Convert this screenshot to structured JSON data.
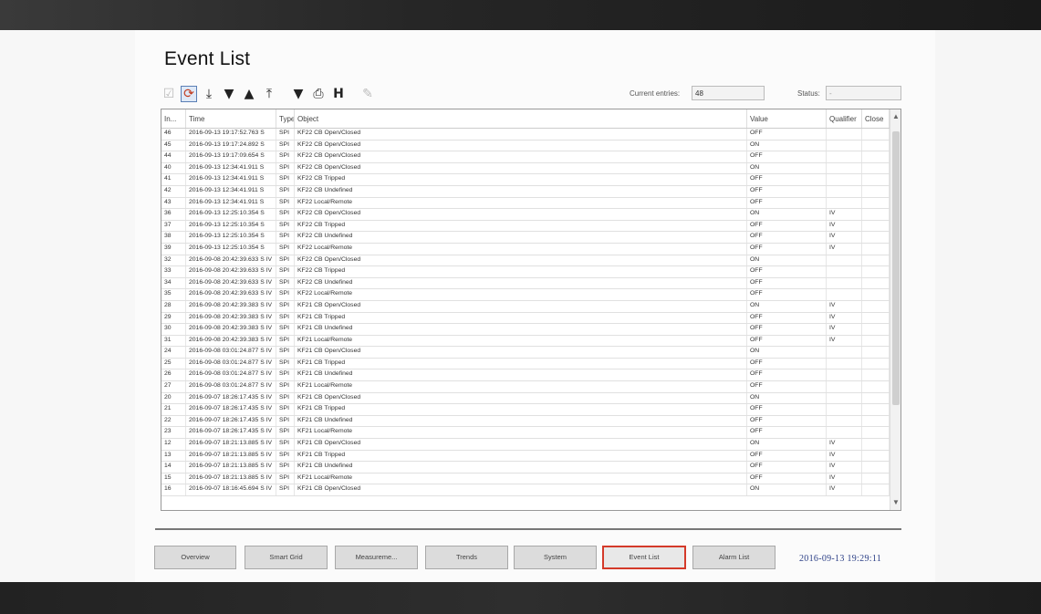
{
  "title": "Event List",
  "toolbar": {
    "buttons": [
      {
        "icon": "acknowledge-icon"
      },
      {
        "icon": "refresh-icon"
      },
      {
        "icon": "jump-first-icon"
      },
      {
        "icon": "move-down-icon"
      },
      {
        "icon": "move-up-icon"
      },
      {
        "icon": "jump-last-icon"
      },
      {
        "icon": "filter-icon"
      },
      {
        "icon": "print-icon"
      },
      {
        "icon": "history-icon"
      },
      {
        "icon": "edit-icon"
      }
    ]
  },
  "current_entries": {
    "label": "Current entries:",
    "value": "48"
  },
  "status": {
    "label": "Status:",
    "value": "-"
  },
  "columns": [
    "In...",
    "Time",
    "Type",
    "Object",
    "Value",
    "Qualifier",
    "Close"
  ],
  "rows": [
    {
      "id": "46",
      "time": "2016-09-13 19:17:52.763 S",
      "type": "SPI",
      "object": "KF22 CB Open/Closed",
      "value": "OFF",
      "qualifier": ""
    },
    {
      "id": "45",
      "time": "2016-09-13 19:17:24.892 S",
      "type": "SPI",
      "object": "KF22 CB Open/Closed",
      "value": "ON",
      "qualifier": ""
    },
    {
      "id": "44",
      "time": "2016-09-13 19:17:09.654 S",
      "type": "SPI",
      "object": "KF22 CB Open/Closed",
      "value": "OFF",
      "qualifier": ""
    },
    {
      "id": "40",
      "time": "2016-09-13 12:34:41.911 S",
      "type": "SPI",
      "object": "KF22 CB Open/Closed",
      "value": "ON",
      "qualifier": ""
    },
    {
      "id": "41",
      "time": "2016-09-13 12:34:41.911 S",
      "type": "SPI",
      "object": "KF22 CB Tripped",
      "value": "OFF",
      "qualifier": ""
    },
    {
      "id": "42",
      "time": "2016-09-13 12:34:41.911 S",
      "type": "SPI",
      "object": "KF22 CB Undefined",
      "value": "OFF",
      "qualifier": ""
    },
    {
      "id": "43",
      "time": "2016-09-13 12:34:41.911 S",
      "type": "SPI",
      "object": "KF22 Local/Remote",
      "value": "OFF",
      "qualifier": ""
    },
    {
      "id": "36",
      "time": "2016-09-13 12:25:10.354 S",
      "type": "SPI",
      "object": "KF22 CB Open/Closed",
      "value": "ON",
      "qualifier": "IV"
    },
    {
      "id": "37",
      "time": "2016-09-13 12:25:10.354 S",
      "type": "SPI",
      "object": "KF22 CB Tripped",
      "value": "OFF",
      "qualifier": "IV"
    },
    {
      "id": "38",
      "time": "2016-09-13 12:25:10.354 S",
      "type": "SPI",
      "object": "KF22 CB Undefined",
      "value": "OFF",
      "qualifier": "IV"
    },
    {
      "id": "39",
      "time": "2016-09-13 12:25:10.354 S",
      "type": "SPI",
      "object": "KF22 Local/Remote",
      "value": "OFF",
      "qualifier": "IV"
    },
    {
      "id": "32",
      "time": "2016-09-08 20:42:39.633 S IV",
      "type": "SPI",
      "object": "KF22 CB Open/Closed",
      "value": "ON",
      "qualifier": ""
    },
    {
      "id": "33",
      "time": "2016-09-08 20:42:39.633 S IV",
      "type": "SPI",
      "object": "KF22 CB Tripped",
      "value": "OFF",
      "qualifier": ""
    },
    {
      "id": "34",
      "time": "2016-09-08 20:42:39.633 S IV",
      "type": "SPI",
      "object": "KF22 CB Undefined",
      "value": "OFF",
      "qualifier": ""
    },
    {
      "id": "35",
      "time": "2016-09-08 20:42:39.633 S IV",
      "type": "SPI",
      "object": "KF22 Local/Remote",
      "value": "OFF",
      "qualifier": ""
    },
    {
      "id": "28",
      "time": "2016-09-08 20:42:39.383 S IV",
      "type": "SPI",
      "object": "KF21 CB Open/Closed",
      "value": "ON",
      "qualifier": "IV"
    },
    {
      "id": "29",
      "time": "2016-09-08 20:42:39.383 S IV",
      "type": "SPI",
      "object": "KF21 CB Tripped",
      "value": "OFF",
      "qualifier": "IV"
    },
    {
      "id": "30",
      "time": "2016-09-08 20:42:39.383 S IV",
      "type": "SPI",
      "object": "KF21 CB Undefined",
      "value": "OFF",
      "qualifier": "IV"
    },
    {
      "id": "31",
      "time": "2016-09-08 20:42:39.383 S IV",
      "type": "SPI",
      "object": "KF21 Local/Remote",
      "value": "OFF",
      "qualifier": "IV"
    },
    {
      "id": "24",
      "time": "2016-09-08 03:01:24.877 S IV",
      "type": "SPI",
      "object": "KF21 CB Open/Closed",
      "value": "ON",
      "qualifier": ""
    },
    {
      "id": "25",
      "time": "2016-09-08 03:01:24.877 S IV",
      "type": "SPI",
      "object": "KF21 CB Tripped",
      "value": "OFF",
      "qualifier": ""
    },
    {
      "id": "26",
      "time": "2016-09-08 03:01:24.877 S IV",
      "type": "SPI",
      "object": "KF21 CB Undefined",
      "value": "OFF",
      "qualifier": ""
    },
    {
      "id": "27",
      "time": "2016-09-08 03:01:24.877 S IV",
      "type": "SPI",
      "object": "KF21 Local/Remote",
      "value": "OFF",
      "qualifier": ""
    },
    {
      "id": "20",
      "time": "2016-09-07 18:26:17.435 S IV",
      "type": "SPI",
      "object": "KF21 CB Open/Closed",
      "value": "ON",
      "qualifier": ""
    },
    {
      "id": "21",
      "time": "2016-09-07 18:26:17.435 S IV",
      "type": "SPI",
      "object": "KF21 CB Tripped",
      "value": "OFF",
      "qualifier": ""
    },
    {
      "id": "22",
      "time": "2016-09-07 18:26:17.435 S IV",
      "type": "SPI",
      "object": "KF21 CB Undefined",
      "value": "OFF",
      "qualifier": ""
    },
    {
      "id": "23",
      "time": "2016-09-07 18:26:17.435 S IV",
      "type": "SPI",
      "object": "KF21 Local/Remote",
      "value": "OFF",
      "qualifier": ""
    },
    {
      "id": "12",
      "time": "2016-09-07 18:21:13.885 S IV",
      "type": "SPI",
      "object": "KF21 CB Open/Closed",
      "value": "ON",
      "qualifier": "IV"
    },
    {
      "id": "13",
      "time": "2016-09-07 18:21:13.885 S IV",
      "type": "SPI",
      "object": "KF21 CB Tripped",
      "value": "OFF",
      "qualifier": "IV"
    },
    {
      "id": "14",
      "time": "2016-09-07 18:21:13.885 S IV",
      "type": "SPI",
      "object": "KF21 CB Undefined",
      "value": "OFF",
      "qualifier": "IV"
    },
    {
      "id": "15",
      "time": "2016-09-07 18:21:13.885 S IV",
      "type": "SPI",
      "object": "KF21 Local/Remote",
      "value": "OFF",
      "qualifier": "IV"
    },
    {
      "id": "16",
      "time": "2016-09-07 18:16:45.694 S IV",
      "type": "SPI",
      "object": "KF21 CB Open/Closed",
      "value": "ON",
      "qualifier": "IV"
    }
  ],
  "nav": {
    "buttons": [
      {
        "label": "Overview",
        "active": false
      },
      {
        "label": "Smart Grid",
        "active": false
      },
      {
        "label": "Measureme...",
        "active": false
      },
      {
        "label": "Trends",
        "active": false
      },
      {
        "label": "System",
        "active": false
      },
      {
        "label": "Event List",
        "active": true
      },
      {
        "label": "Alarm List",
        "active": false
      }
    ],
    "datetime": "2016-09-13 19:29:11"
  },
  "colors": {
    "active_border": "#d43a2a",
    "datetime": "#2b3f86"
  }
}
